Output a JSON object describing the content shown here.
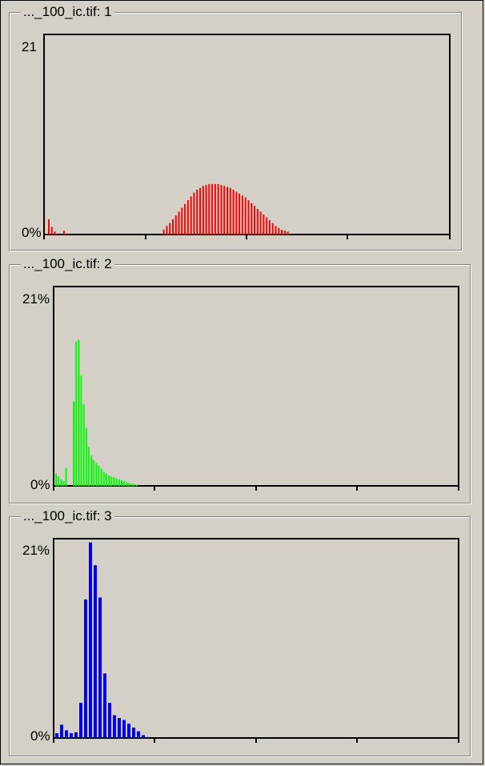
{
  "panels": [
    {
      "title": "..._100_ic.tif: 1"
    },
    {
      "title": "..._100_ic.tif: 2"
    },
    {
      "title": "..._100_ic.tif: 3"
    }
  ],
  "chart_data": [
    {
      "type": "bar",
      "title": "..._100_ic.tif: 1",
      "color": "#ff0000",
      "ylim": [
        0,
        21
      ],
      "ytick_labels": [
        "21",
        "0%"
      ],
      "x": [
        0,
        1,
        2,
        3,
        4,
        5,
        6,
        7,
        8,
        9,
        10,
        11,
        12,
        13,
        14,
        15,
        16,
        17,
        18,
        19,
        20,
        21,
        22,
        23,
        24,
        25,
        26,
        27,
        28,
        29,
        30,
        31,
        32,
        33,
        34,
        35,
        36,
        37,
        38,
        39,
        40,
        41,
        42,
        43,
        44,
        45,
        46,
        47,
        48,
        49,
        50,
        51,
        52,
        53,
        54,
        55,
        56,
        57,
        58,
        59,
        60,
        61,
        62,
        63,
        64,
        65,
        66,
        67,
        68,
        69,
        70,
        71,
        72,
        73,
        74,
        75,
        76,
        77,
        78,
        79
      ],
      "values": [
        1.6,
        0.8,
        0.3,
        0,
        0,
        0.4,
        0,
        0,
        0,
        0,
        0,
        0,
        0,
        0,
        0,
        0,
        0,
        0,
        0,
        0,
        0,
        0,
        0,
        0,
        0,
        0,
        0,
        0,
        0,
        0,
        0,
        0,
        0,
        0,
        0,
        0,
        0,
        0,
        0.5,
        0.9,
        1.2,
        1.6,
        2.0,
        2.4,
        2.8,
        3.2,
        3.6,
        4.0,
        4.4,
        4.7,
        4.9,
        5.1,
        5.2,
        5.3,
        5.3,
        5.3,
        5.3,
        5.2,
        5.1,
        5.0,
        4.9,
        4.7,
        4.5,
        4.3,
        4.1,
        3.9,
        3.6,
        3.3,
        3.0,
        2.7,
        2.4,
        2.1,
        1.8,
        1.5,
        1.2,
        0.9,
        0.7,
        0.5,
        0.4,
        0.3
      ]
    },
    {
      "type": "bar",
      "title": "..._100_ic.tif: 2",
      "color": "#00ff00",
      "ylim": [
        0,
        21
      ],
      "ytick_labels": [
        "21%",
        "0%"
      ],
      "x": [
        0,
        1,
        2,
        3,
        4,
        5,
        6,
        7,
        8,
        9,
        10,
        11,
        12,
        13,
        14,
        15,
        16,
        17,
        18,
        19,
        20,
        21,
        22,
        23,
        24,
        25,
        26,
        27,
        28,
        29,
        30,
        31,
        32,
        33
      ],
      "values": [
        1.3,
        1.0,
        0.7,
        0.5,
        1.9,
        0,
        0,
        8.9,
        15.2,
        15.4,
        11.6,
        8.6,
        6.1,
        4.1,
        3.2,
        2.7,
        2.4,
        2.1,
        1.8,
        1.5,
        1.3,
        1.1,
        1.0,
        0.9,
        0.8,
        0.7,
        0.6,
        0.5,
        0.4,
        0.3,
        0.25,
        0.2,
        0.1,
        0
      ]
    },
    {
      "type": "bar",
      "title": "..._100_ic.tif: 3",
      "color": "#0000ff",
      "ylim": [
        0,
        21
      ],
      "ytick_labels": [
        "21%",
        "0%"
      ],
      "x": [
        0,
        1,
        2,
        3,
        4,
        5,
        6,
        7,
        8,
        9,
        10,
        11,
        12,
        13,
        14,
        15,
        16,
        17,
        18,
        19,
        20,
        21,
        22,
        23,
        24,
        25
      ],
      "values": [
        0.5,
        1.4,
        0.8,
        0.5,
        0.6,
        3.7,
        14.6,
        20.6,
        18.2,
        14.8,
        6.8,
        3.7,
        2.4,
        2.1,
        1.9,
        1.5,
        1.1,
        0.7,
        0.3,
        0.1,
        0,
        0,
        0,
        0,
        0,
        0
      ]
    }
  ]
}
